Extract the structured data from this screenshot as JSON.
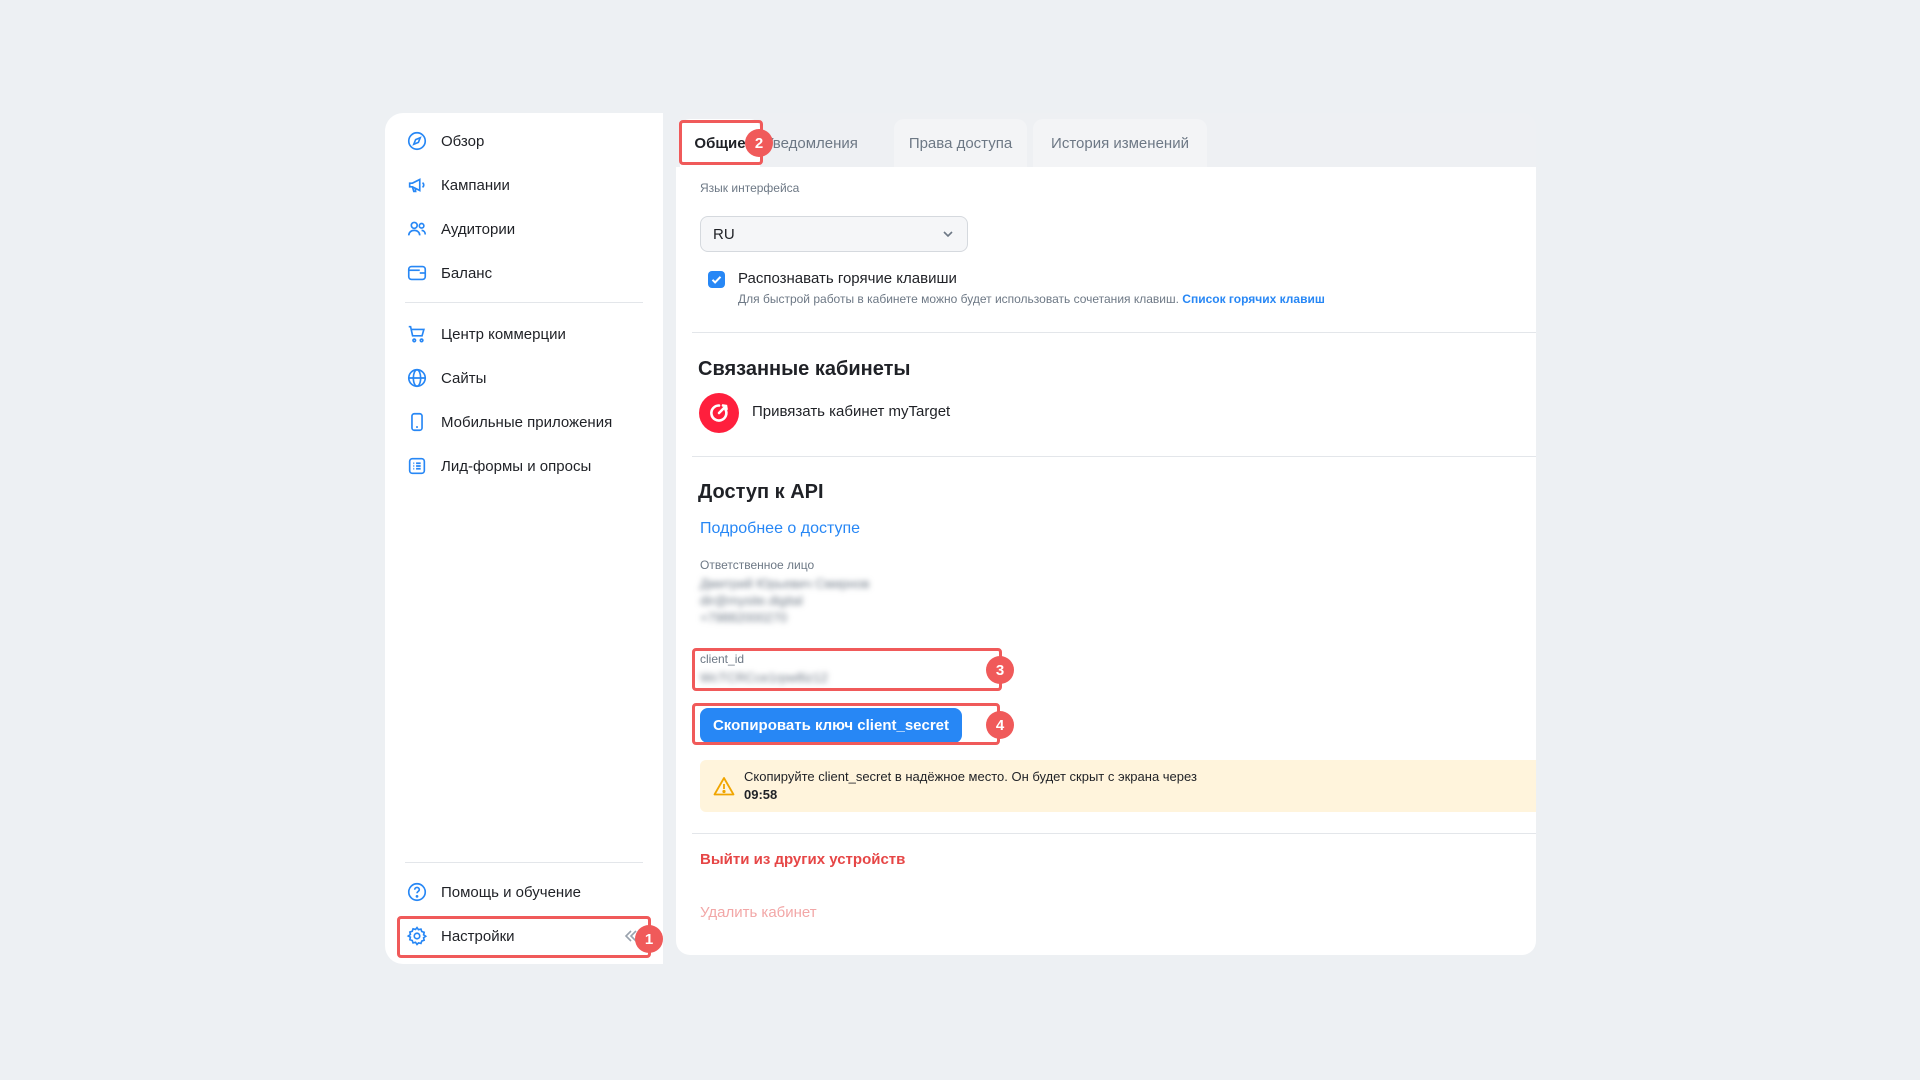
{
  "sidebar": {
    "items": [
      {
        "label": "Обзор",
        "icon": "compass-icon"
      },
      {
        "label": "Кампании",
        "icon": "megaphone-icon"
      },
      {
        "label": "Аудитории",
        "icon": "users-icon"
      },
      {
        "label": "Баланс",
        "icon": "wallet-icon"
      },
      {
        "label": "Центр коммерции",
        "icon": "cart-icon"
      },
      {
        "label": "Сайты",
        "icon": "globe-icon"
      },
      {
        "label": "Мобильные приложения",
        "icon": "phone-icon"
      },
      {
        "label": "Лид-формы и опросы",
        "icon": "list-form-icon"
      }
    ],
    "bottom": [
      {
        "label": "Помощь и обучение",
        "icon": "help-icon"
      },
      {
        "label": "Настройки",
        "icon": "gear-icon"
      }
    ]
  },
  "tabs": [
    {
      "label": "Общие",
      "active": true
    },
    {
      "label": "Уведомления"
    },
    {
      "label": "Права доступа"
    },
    {
      "label": "История изменений"
    }
  ],
  "general": {
    "language_label": "Язык интерфейса",
    "language_value": "RU",
    "hotkeys_title": "Распознавать горячие клавиши",
    "hotkeys_desc": "Для быстрой работы в кабинете можно будет использовать сочетания клавиш.",
    "hotkeys_link": "Список горячих клавиш",
    "hotkeys_checked": true
  },
  "linked": {
    "title": "Связанные кабинеты",
    "mytarget_label": "Привязать кабинет myTarget"
  },
  "api": {
    "title": "Доступ к API",
    "more_link": "Подробнее о доступе",
    "responsible_label": "Ответственное лицо",
    "responsible_name": "Дмитрий Юрьевич Смирнов",
    "responsible_email": "dir@mysite.digital",
    "responsible_phone": "+79882000270",
    "client_id_label": "client_id",
    "client_id_value": "WcTCRCce1rpw8iz12",
    "copy_button": "Скопировать ключ client_secret",
    "warning_text": "Скопируйте client_secret в надёжное место. Он будет скрыт с экрана через",
    "warning_time": "09:58"
  },
  "danger": {
    "logout_others": "Выйти из других устройств",
    "delete_account": "Удалить кабинет"
  },
  "annotations": [
    "1",
    "2",
    "3",
    "4"
  ],
  "colors": {
    "accent": "#2787f5",
    "highlight": "#f05a5a",
    "danger": "#e64646",
    "warning_bg": "#fff4dc",
    "mytarget": "#ff1f3d"
  }
}
